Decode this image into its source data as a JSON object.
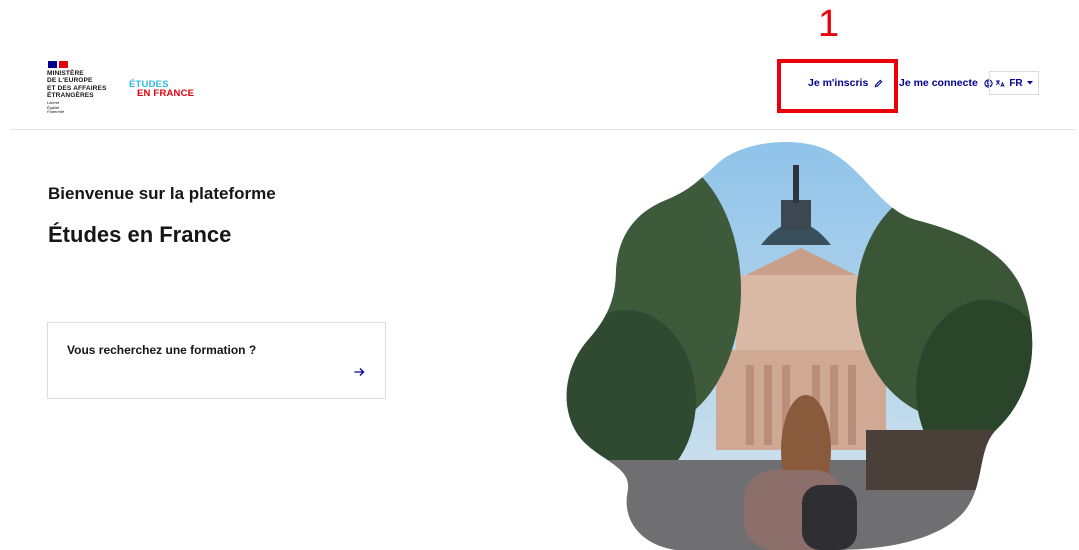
{
  "header": {
    "ministry_lines": [
      "MINISTÈRE",
      "DE L'EUROPE",
      "ET DES AFFAIRES",
      "ÉTRANGÈRES"
    ],
    "motto_lines": [
      "Liberté",
      "Égalité",
      "Fraternité"
    ],
    "logo": {
      "top": "ÉTUDES",
      "bottom": "EN FRANCE"
    },
    "nav": {
      "register_label": "Je m'inscris",
      "login_label": "Je me connecte",
      "language_label": "FR"
    }
  },
  "annotation": {
    "number": "1"
  },
  "main": {
    "welcome": "Bienvenue sur la plateforme",
    "platform_name": "Études en France",
    "search_card": {
      "title": "Vous recherchez une formation ?"
    }
  },
  "colors": {
    "brand_blue": "#000091",
    "brand_red": "#e1000f",
    "logo_cyan": "#2fb9e0",
    "annotation_red": "#e8000b"
  }
}
